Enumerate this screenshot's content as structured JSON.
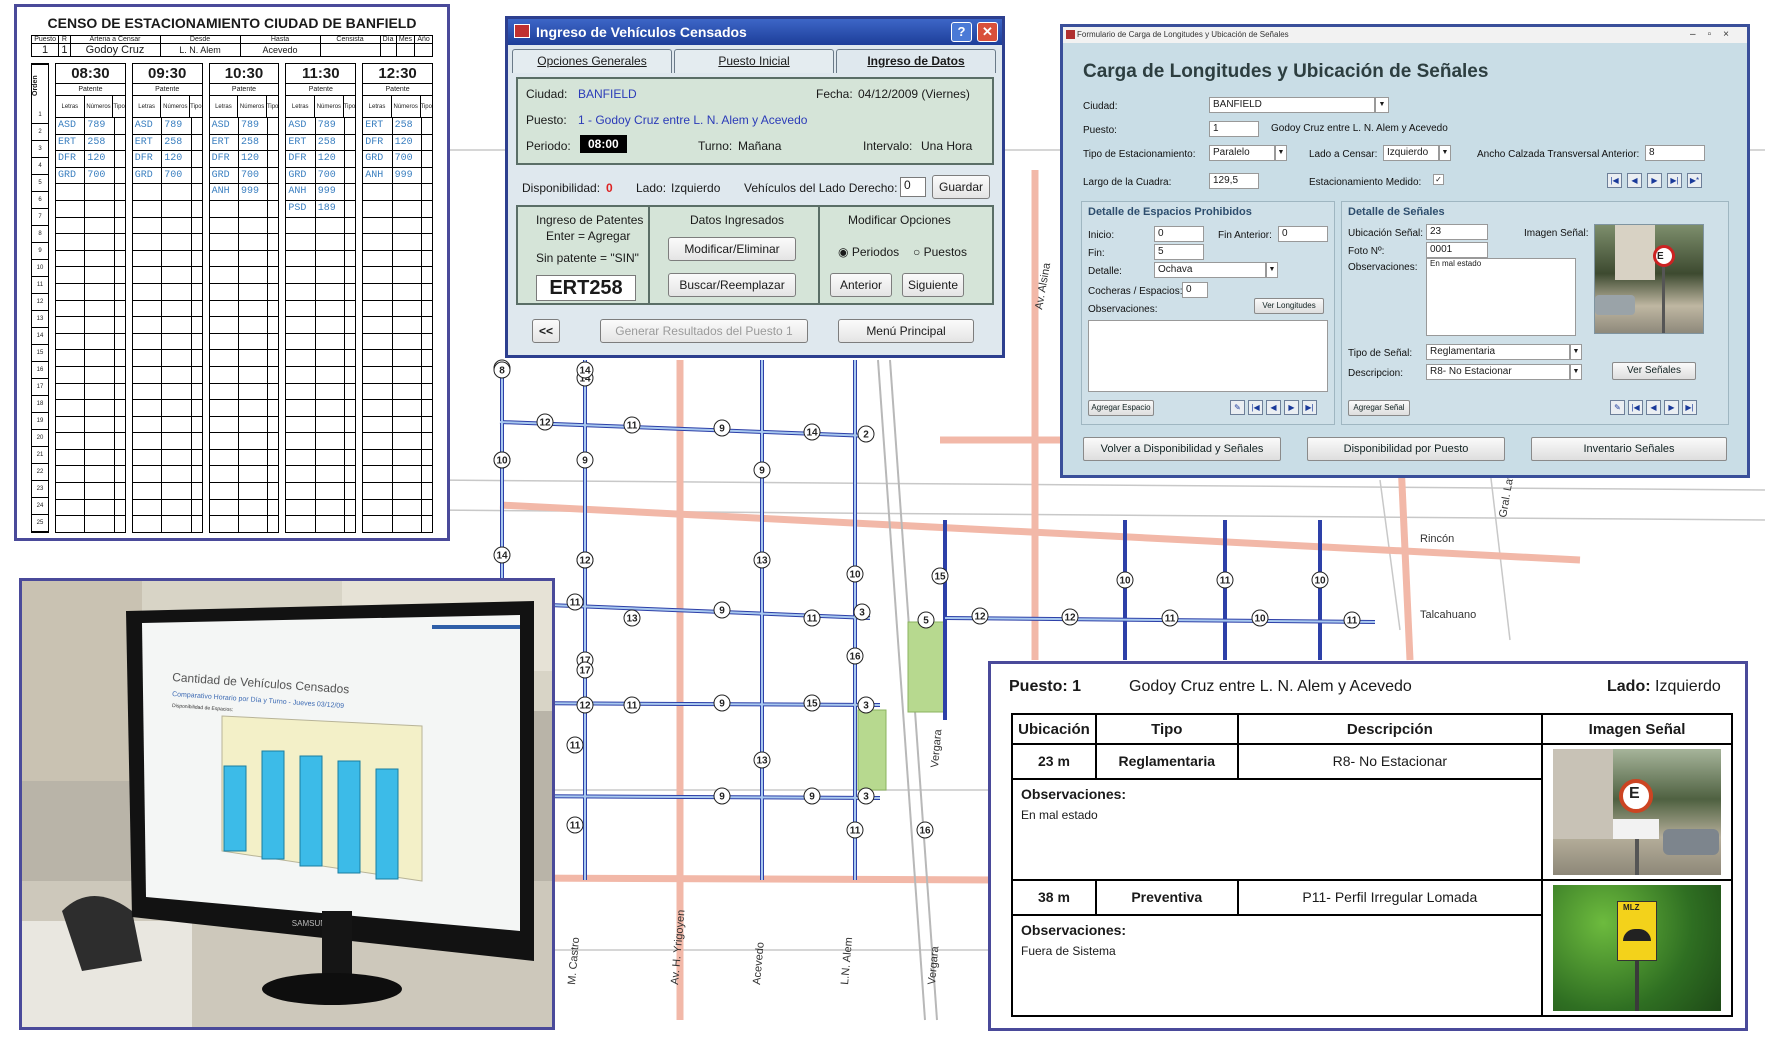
{
  "paper_form": {
    "title": "CENSO DE ESTACIONAMIENTO CIUDAD DE BANFIELD",
    "header_labels": [
      "Puesto",
      "R",
      "Arteria a Censar",
      "Desde",
      "Hasta",
      "Censista",
      "Día",
      "Mes",
      "Año"
    ],
    "header_values": [
      "1",
      "1",
      "Godoy Cruz",
      "L. N. Alem",
      "Acevedo",
      "",
      "",
      "",
      ""
    ],
    "orden_label": "Orden",
    "row_numbers": [
      "1",
      "2",
      "3",
      "4",
      "5",
      "6",
      "7",
      "8",
      "9",
      "10",
      "11",
      "12",
      "13",
      "14",
      "15",
      "16",
      "17",
      "18",
      "19",
      "20",
      "21",
      "22",
      "23",
      "24",
      "25"
    ],
    "patente_label": "Patente",
    "letras_label": "Letras",
    "numeros_label": "Números",
    "tipo_label": "Tipo",
    "times": [
      {
        "time": "08:30",
        "entries": [
          [
            "ASD",
            "789"
          ],
          [
            "ERT",
            "258"
          ],
          [
            "DFR",
            "120"
          ],
          [
            "GRD",
            "700"
          ]
        ]
      },
      {
        "time": "09:30",
        "entries": [
          [
            "ASD",
            "789"
          ],
          [
            "ERT",
            "258"
          ],
          [
            "DFR",
            "120"
          ],
          [
            "GRD",
            "700"
          ]
        ]
      },
      {
        "time": "10:30",
        "entries": [
          [
            "ASD",
            "789"
          ],
          [
            "ERT",
            "258"
          ],
          [
            "DFR",
            "120"
          ],
          [
            "GRD",
            "700"
          ],
          [
            "ANH",
            "999"
          ]
        ]
      },
      {
        "time": "11:30",
        "entries": [
          [
            "ASD",
            "789"
          ],
          [
            "ERT",
            "258"
          ],
          [
            "DFR",
            "120"
          ],
          [
            "GRD",
            "700"
          ],
          [
            "ANH",
            "999"
          ],
          [
            "PSD",
            "189"
          ]
        ]
      },
      {
        "time": "12:30",
        "entries": [
          [
            "ERT",
            "258"
          ],
          [
            "DFR",
            "120"
          ],
          [
            "GRD",
            "700"
          ],
          [
            "ANH",
            "999"
          ]
        ]
      }
    ]
  },
  "dialog": {
    "title": "Ingreso de Vehículos Censados",
    "tabs": [
      "Opciones Generales",
      "Puesto Inicial",
      "Ingreso de Datos"
    ],
    "ciudad_label": "Ciudad:",
    "ciudad_value": "BANFIELD",
    "fecha_label": "Fecha:",
    "fecha_value": "04/12/2009 (Viernes)",
    "puesto_label": "Puesto:",
    "puesto_value": "1 -   Godoy Cruz entre L. N. Alem y Acevedo",
    "periodo_label": "Periodo:",
    "periodo_value": "08:00",
    "turno_label": "Turno:",
    "turno_value": "Mañana",
    "intervalo_label": "Intervalo:",
    "intervalo_value": "Una Hora",
    "disponibilidad_label": "Disponibilidad:",
    "disponibilidad_value": "0",
    "lado_label": "Lado:",
    "lado_value": "Izquierdo",
    "vehiculos_label": "Vehículos del Lado Derecho:",
    "vehiculos_value": "0",
    "guardar": "Guardar",
    "ingreso_patentes": "Ingreso de Patentes",
    "enter_agregar": "Enter = Agregar",
    "sin_patente": "Sin patente = \"SIN\"",
    "patente_value": "ERT258",
    "datos_ingresados": "Datos Ingresados",
    "modificar": "Modificar/Eliminar",
    "buscar": "Buscar/Reemplazar",
    "modificar_opciones": "Modificar Opciones",
    "periodos": "Periodos",
    "puestos": "Puestos",
    "anterior": "Anterior",
    "siguiente": "Siguiente",
    "back_btn": "<<",
    "generar": "Generar Resultados del Puesto 1",
    "menu_principal": "Menú Principal"
  },
  "access_form": {
    "window_title": "Formulario de Carga de Longitudes y Ubicación de Señales",
    "heading": "Carga de Longitudes y Ubicación de Señales",
    "ciudad_label": "Ciudad:",
    "ciudad_value": "BANFIELD",
    "puesto_label": "Puesto:",
    "puesto_value": "1",
    "puesto_desc": "Godoy Cruz entre L. N. Alem y Acevedo",
    "tipo_label": "Tipo de Estacionamiento:",
    "tipo_value": "Paralelo",
    "lado_label": "Lado a Censar:",
    "lado_value": "Izquierdo",
    "ancho_label": "Ancho Calzada Transversal Anterior:",
    "ancho_value": "8",
    "largo_label": "Largo de la Cuadra:",
    "largo_value": "129,5",
    "medido_label": "Estacionamiento Medido:",
    "espacios_title": "Detalle de Espacios Prohibidos",
    "inicio_label": "Inicio:",
    "inicio_value": "0",
    "fin_anterior_label": "Fin Anterior:",
    "fin_anterior_value": "0",
    "fin_label": "Fin:",
    "fin_value": "5",
    "detalle_label": "Detalle:",
    "detalle_value": "Ochava",
    "cocheras_label": "Cocheras / Espacios:",
    "cocheras_value": "0",
    "observaciones_label": "Observaciones:",
    "ver_longitudes": "Ver Longitudes",
    "agregar_espacio": "Agregar Espacio",
    "senales_title": "Detalle de Señales",
    "ubicacion_label": "Ubicación Señal:",
    "ubicacion_value": "23",
    "imagen_label": "Imagen Señal:",
    "foto_label": "Foto Nº:",
    "foto_value": "0001",
    "obs_label": "Observaciones:",
    "obs_value": "En mal estado",
    "tipo_senal_label": "Tipo de Señal:",
    "tipo_senal_value": "Reglamentaria",
    "descripcion_label": "Descripcion:",
    "descripcion_value": "R8- No Estacionar",
    "ver_senales": "Ver Señales",
    "agregar_senal": "Agregar Señal",
    "volver": "Volver a Disponibilidad y Señales",
    "disponibilidad_puesto": "Disponibilidad por Puesto",
    "inventario": "Inventario Señales"
  },
  "photo": {
    "screen_title": "Cantidad de Vehículos Censados",
    "screen_subtitle": "Comparativo Horario por Día y Turno - Jueves 03/12/09",
    "screen_note": "Disponibilidad de Espacios:",
    "brand": "SAMSUNG"
  },
  "report": {
    "puesto_label": "Puesto:",
    "puesto_value": "1",
    "puesto_desc": "Godoy Cruz  entre  L. N. Alem  y  Acevedo",
    "lado_label": "Lado:",
    "lado_value": "Izquierdo",
    "headers": [
      "Ubicación",
      "Tipo",
      "Descripción",
      "Imagen Señal"
    ],
    "rows": [
      {
        "ubicacion": "23 m",
        "tipo": "Reglamentaria",
        "descripcion": "R8- No Estacionar",
        "obs_label": "Observaciones:",
        "obs": "En mal estado"
      },
      {
        "ubicacion": "38 m",
        "tipo": "Preventiva",
        "descripcion": "P11- Perfil Irregular Lomada",
        "obs_label": "Observaciones:",
        "obs": "Fuera de Sistema"
      }
    ],
    "sign2_text": "MLZ"
  },
  "map": {
    "street_labels": [
      "Av. Alsina",
      "Gral. Lavalle",
      "Rincón",
      "Talcahuano",
      "Vergara",
      "M. Castro",
      "Av. H. Yrigoyen",
      "Acevedo",
      "L.N. Alem",
      "Vergara"
    ],
    "route_numbers": [
      "12",
      "11",
      "9",
      "14",
      "2",
      "8",
      "10",
      "9",
      "12",
      "14",
      "17",
      "11",
      "13",
      "9",
      "11",
      "3",
      "10",
      "16",
      "15",
      "5",
      "12",
      "12",
      "11",
      "10",
      "11",
      "11",
      "12",
      "9",
      "15",
      "3",
      "11",
      "9",
      "9",
      "3",
      "11",
      "13",
      "10",
      "11",
      "10",
      "9",
      "8",
      "16",
      "11",
      "13",
      "17",
      "12",
      "14",
      "10",
      "14"
    ]
  }
}
